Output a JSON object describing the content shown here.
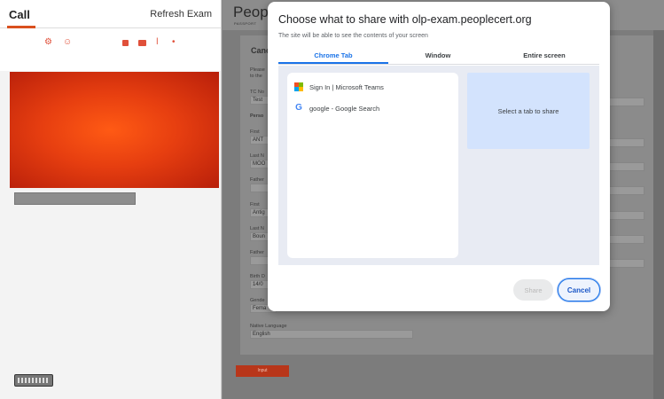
{
  "call_panel": {
    "tab_label": "Call",
    "refresh_label": "Refresh Exam",
    "controls": [
      "settings-icon",
      "chat-icon",
      "screen-share-icon",
      "camera-icon",
      "microphone-icon",
      "record-icon"
    ]
  },
  "exam_page": {
    "brand": "People",
    "brand_sub": "PASSPORT",
    "card_title": "Canc",
    "intro_lines": [
      "Please",
      "to the"
    ],
    "fields": [
      {
        "label": "TC No",
        "value": "Test"
      },
      {
        "label": "Perso",
        "value": ""
      },
      {
        "label": "First",
        "value": "ANT"
      },
      {
        "label": "Last N",
        "value": "MOO"
      },
      {
        "label": "Father",
        "value": ""
      },
      {
        "label": "First",
        "value": "Antig"
      },
      {
        "label": "Last N",
        "value": "Boun"
      },
      {
        "label": "Father",
        "value": ""
      },
      {
        "label": "Birth D",
        "value": "14/0"
      },
      {
        "label": "Gende",
        "value": "Fema"
      },
      {
        "label": "Native Language",
        "value": "English"
      }
    ],
    "submit_label": "Input"
  },
  "dialog": {
    "title": "Choose what to share with olp-exam.peoplecert.org",
    "subtitle": "The site will be able to see the contents of your screen",
    "tabs": [
      {
        "label": "Chrome Tab",
        "active": true
      },
      {
        "label": "Window",
        "active": false
      },
      {
        "label": "Entire screen",
        "active": false
      }
    ],
    "tab_items": [
      {
        "label": "Sign In | Microsoft Teams",
        "icon": "microsoft-icon"
      },
      {
        "label": "google - Google Search",
        "icon": "google-icon"
      }
    ],
    "preview_text": "Select a tab to share",
    "share_label": "Share",
    "cancel_label": "Cancel",
    "accent_color": "#1a73e8"
  }
}
